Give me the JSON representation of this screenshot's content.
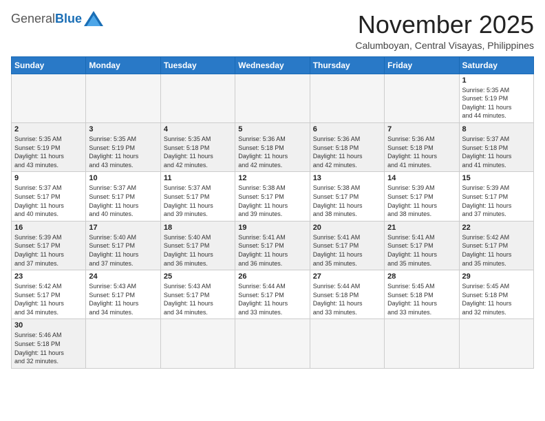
{
  "header": {
    "logo_general": "General",
    "logo_blue": "Blue",
    "month_title": "November 2025",
    "location": "Calumboyan, Central Visayas, Philippines"
  },
  "days_of_week": [
    "Sunday",
    "Monday",
    "Tuesday",
    "Wednesday",
    "Thursday",
    "Friday",
    "Saturday"
  ],
  "weeks": [
    [
      {
        "day": "",
        "info": ""
      },
      {
        "day": "",
        "info": ""
      },
      {
        "day": "",
        "info": ""
      },
      {
        "day": "",
        "info": ""
      },
      {
        "day": "",
        "info": ""
      },
      {
        "day": "",
        "info": ""
      },
      {
        "day": "1",
        "info": "Sunrise: 5:35 AM\nSunset: 5:19 PM\nDaylight: 11 hours\nand 44 minutes."
      }
    ],
    [
      {
        "day": "2",
        "info": "Sunrise: 5:35 AM\nSunset: 5:19 PM\nDaylight: 11 hours\nand 43 minutes."
      },
      {
        "day": "3",
        "info": "Sunrise: 5:35 AM\nSunset: 5:19 PM\nDaylight: 11 hours\nand 43 minutes."
      },
      {
        "day": "4",
        "info": "Sunrise: 5:35 AM\nSunset: 5:18 PM\nDaylight: 11 hours\nand 42 minutes."
      },
      {
        "day": "5",
        "info": "Sunrise: 5:36 AM\nSunset: 5:18 PM\nDaylight: 11 hours\nand 42 minutes."
      },
      {
        "day": "6",
        "info": "Sunrise: 5:36 AM\nSunset: 5:18 PM\nDaylight: 11 hours\nand 42 minutes."
      },
      {
        "day": "7",
        "info": "Sunrise: 5:36 AM\nSunset: 5:18 PM\nDaylight: 11 hours\nand 41 minutes."
      },
      {
        "day": "8",
        "info": "Sunrise: 5:37 AM\nSunset: 5:18 PM\nDaylight: 11 hours\nand 41 minutes."
      }
    ],
    [
      {
        "day": "9",
        "info": "Sunrise: 5:37 AM\nSunset: 5:17 PM\nDaylight: 11 hours\nand 40 minutes."
      },
      {
        "day": "10",
        "info": "Sunrise: 5:37 AM\nSunset: 5:17 PM\nDaylight: 11 hours\nand 40 minutes."
      },
      {
        "day": "11",
        "info": "Sunrise: 5:37 AM\nSunset: 5:17 PM\nDaylight: 11 hours\nand 39 minutes."
      },
      {
        "day": "12",
        "info": "Sunrise: 5:38 AM\nSunset: 5:17 PM\nDaylight: 11 hours\nand 39 minutes."
      },
      {
        "day": "13",
        "info": "Sunrise: 5:38 AM\nSunset: 5:17 PM\nDaylight: 11 hours\nand 38 minutes."
      },
      {
        "day": "14",
        "info": "Sunrise: 5:39 AM\nSunset: 5:17 PM\nDaylight: 11 hours\nand 38 minutes."
      },
      {
        "day": "15",
        "info": "Sunrise: 5:39 AM\nSunset: 5:17 PM\nDaylight: 11 hours\nand 37 minutes."
      }
    ],
    [
      {
        "day": "16",
        "info": "Sunrise: 5:39 AM\nSunset: 5:17 PM\nDaylight: 11 hours\nand 37 minutes."
      },
      {
        "day": "17",
        "info": "Sunrise: 5:40 AM\nSunset: 5:17 PM\nDaylight: 11 hours\nand 37 minutes."
      },
      {
        "day": "18",
        "info": "Sunrise: 5:40 AM\nSunset: 5:17 PM\nDaylight: 11 hours\nand 36 minutes."
      },
      {
        "day": "19",
        "info": "Sunrise: 5:41 AM\nSunset: 5:17 PM\nDaylight: 11 hours\nand 36 minutes."
      },
      {
        "day": "20",
        "info": "Sunrise: 5:41 AM\nSunset: 5:17 PM\nDaylight: 11 hours\nand 35 minutes."
      },
      {
        "day": "21",
        "info": "Sunrise: 5:41 AM\nSunset: 5:17 PM\nDaylight: 11 hours\nand 35 minutes."
      },
      {
        "day": "22",
        "info": "Sunrise: 5:42 AM\nSunset: 5:17 PM\nDaylight: 11 hours\nand 35 minutes."
      }
    ],
    [
      {
        "day": "23",
        "info": "Sunrise: 5:42 AM\nSunset: 5:17 PM\nDaylight: 11 hours\nand 34 minutes."
      },
      {
        "day": "24",
        "info": "Sunrise: 5:43 AM\nSunset: 5:17 PM\nDaylight: 11 hours\nand 34 minutes."
      },
      {
        "day": "25",
        "info": "Sunrise: 5:43 AM\nSunset: 5:17 PM\nDaylight: 11 hours\nand 34 minutes."
      },
      {
        "day": "26",
        "info": "Sunrise: 5:44 AM\nSunset: 5:17 PM\nDaylight: 11 hours\nand 33 minutes."
      },
      {
        "day": "27",
        "info": "Sunrise: 5:44 AM\nSunset: 5:18 PM\nDaylight: 11 hours\nand 33 minutes."
      },
      {
        "day": "28",
        "info": "Sunrise: 5:45 AM\nSunset: 5:18 PM\nDaylight: 11 hours\nand 33 minutes."
      },
      {
        "day": "29",
        "info": "Sunrise: 5:45 AM\nSunset: 5:18 PM\nDaylight: 11 hours\nand 32 minutes."
      }
    ],
    [
      {
        "day": "30",
        "info": "Sunrise: 5:46 AM\nSunset: 5:18 PM\nDaylight: 11 hours\nand 32 minutes."
      },
      {
        "day": "",
        "info": ""
      },
      {
        "day": "",
        "info": ""
      },
      {
        "day": "",
        "info": ""
      },
      {
        "day": "",
        "info": ""
      },
      {
        "day": "",
        "info": ""
      },
      {
        "day": "",
        "info": ""
      }
    ]
  ]
}
